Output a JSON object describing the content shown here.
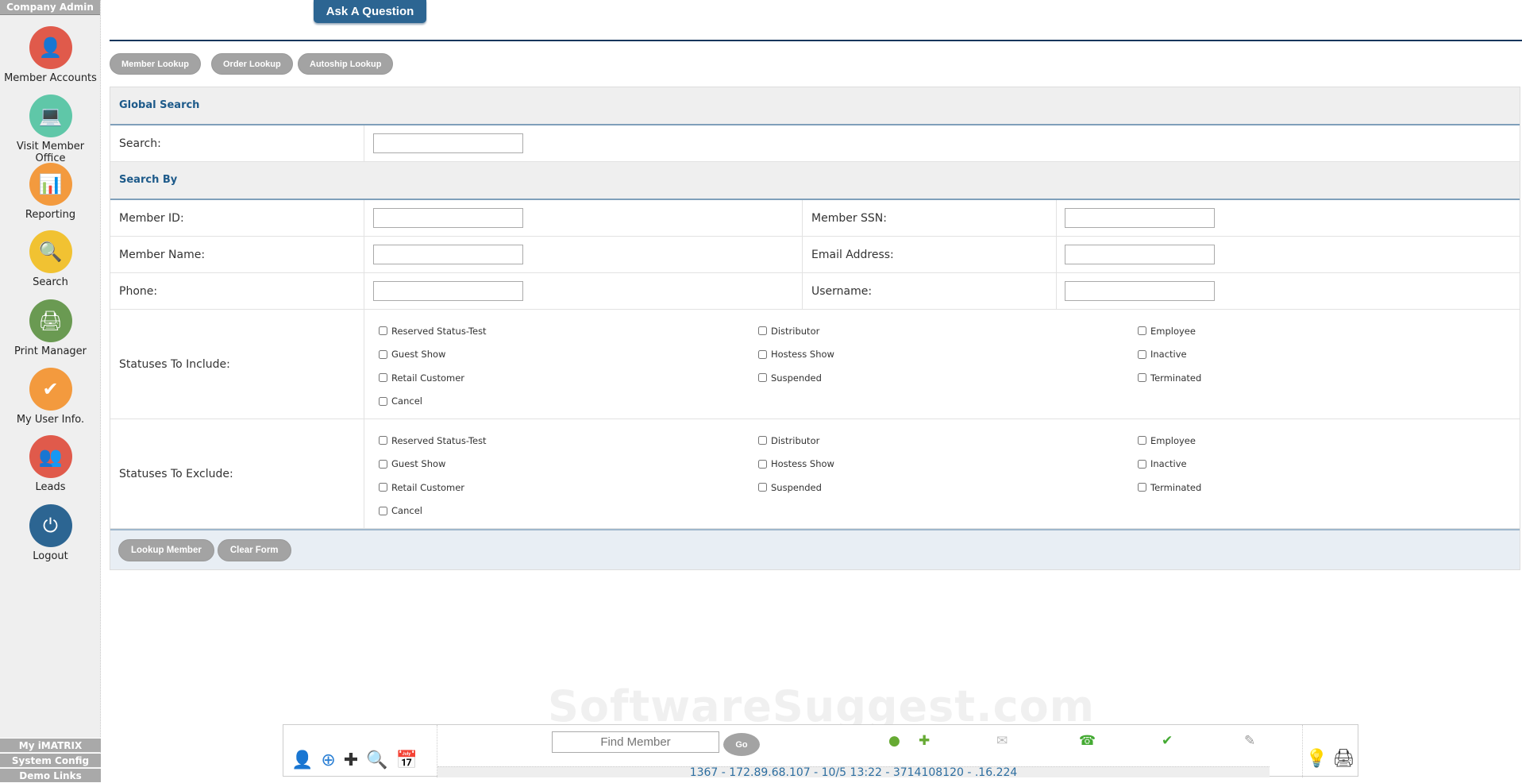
{
  "sidebar": {
    "title": "Company Admin",
    "items": [
      {
        "label": "Member Accounts",
        "icon": "user-icon",
        "color": "#e05a4b",
        "glyph": "👤"
      },
      {
        "label": "Visit Member Office",
        "icon": "laptop-icon",
        "color": "#5fc7a8",
        "glyph": "💻"
      },
      {
        "label": "Reporting",
        "icon": "chart-icon",
        "color": "#f39a3e",
        "glyph": "📊"
      },
      {
        "label": "Search",
        "icon": "magnifier-icon",
        "color": "#f1c232",
        "glyph": "🔍"
      },
      {
        "label": "Print Manager",
        "icon": "printer-icon",
        "color": "#6a9a52",
        "glyph": "🖨"
      },
      {
        "label": "My User Info.",
        "icon": "checkmark-icon",
        "color": "#f39a3e",
        "glyph": "✔"
      },
      {
        "label": "Leads",
        "icon": "group-icon",
        "color": "#e05a4b",
        "glyph": "👥"
      },
      {
        "label": "Logout",
        "icon": "power-icon",
        "color": "#2c6592",
        "glyph": "⏻"
      }
    ],
    "bottom": [
      "My iMATRIX",
      "System Config",
      "Demo Links"
    ]
  },
  "header": {
    "ask": "Ask A Question"
  },
  "tabs": [
    "Member Lookup",
    "Order Lookup",
    "Autoship Lookup"
  ],
  "form": {
    "global_search": "Global Search",
    "search_label": "Search:",
    "search_by": "Search By",
    "member_id": "Member ID:",
    "member_ssn": "Member SSN:",
    "member_name": "Member Name:",
    "email": "Email Address:",
    "phone": "Phone:",
    "username": "Username:",
    "include": "Statuses To Include:",
    "exclude": "Statuses To Exclude:",
    "statuses": [
      "Reserved Status-Test",
      "Distributor",
      "Employee",
      "Guest Show",
      "Hostess Show",
      "Inactive",
      "Retail Customer",
      "Suspended",
      "Terminated",
      "Cancel"
    ],
    "lookup": "Lookup Member",
    "clear": "Clear Form"
  },
  "watermark": "SoftwareSuggest.com",
  "toolbar": {
    "find_placeholder": "Find Member",
    "go": "Go",
    "status": "1367 - 172.89.68.107 - 10/5 13:22 - 3714108120 - .16.224"
  }
}
